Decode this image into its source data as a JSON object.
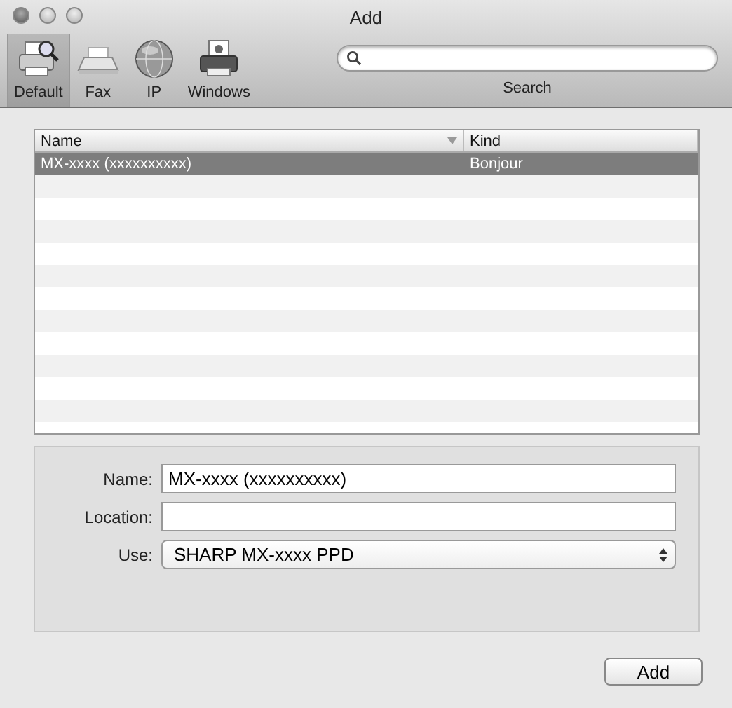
{
  "window": {
    "title": "Add"
  },
  "toolbar": [
    {
      "label": "Default",
      "kind": "default",
      "selected": true
    },
    {
      "label": "Fax",
      "kind": "fax",
      "selected": false
    },
    {
      "label": "IP",
      "kind": "ip",
      "selected": false
    },
    {
      "label": "Windows",
      "kind": "windows",
      "selected": false
    }
  ],
  "search": {
    "label": "Search"
  },
  "table": {
    "columns": [
      "Name",
      "Kind"
    ],
    "rows": [
      {
        "name": "MX-xxxx (xxxxxxxxxx)",
        "kind": "Bonjour",
        "selected": true
      }
    ]
  },
  "form": {
    "name_label": "Name:",
    "name_value": "MX-xxxx (xxxxxxxxxx)",
    "location_label": "Location:",
    "use_label": "Use:",
    "use_value": "SHARP MX-xxxx PPD"
  },
  "buttons": [
    "Add"
  ]
}
